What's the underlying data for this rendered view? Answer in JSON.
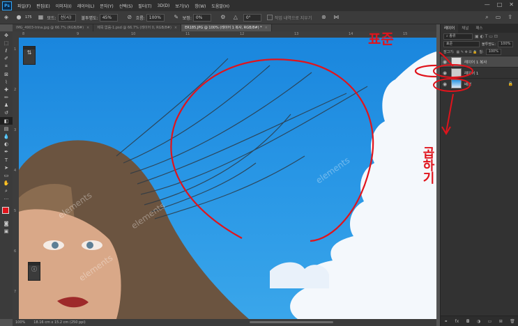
{
  "menu": {
    "logo": "Ps",
    "items": [
      "파일(F)",
      "편집(E)",
      "이미지(I)",
      "레이어(L)",
      "문자(Y)",
      "선택(S)",
      "필터(T)",
      "3D(D)",
      "보기(V)",
      "창(W)",
      "도움말(H)"
    ],
    "window_controls": [
      "—",
      "□",
      "✕"
    ]
  },
  "options": {
    "mode_label": "모드:",
    "mode_value": "선(시)",
    "opacity_label": "불투명도:",
    "opacity_value": "45%",
    "flow_label": "흐름:",
    "flow_value": "100%",
    "smooth_label": "보정:",
    "smooth_value": "0%",
    "angle_value": "0°",
    "erase_history": "작업 내역으로 지우기",
    "brush_size": "175"
  },
  "tabs": [
    {
      "label": "IMG_4903-trina.jpg @ 66.7% (RGB/8#)",
      "active": false
    },
    {
      "label": "제목 없음-1.psd @ 66.7% (레이어 0, RGB/8#)",
      "active": false
    },
    {
      "label": "ER185.JPG @ 100% (레이어 1 복사, RGB/8#) *",
      "active": true
    }
  ],
  "ruler": {
    "top": [
      "8",
      "9",
      "10",
      "11",
      "12",
      "13",
      "14",
      "15"
    ],
    "left": [
      "1",
      "2",
      "3",
      "4",
      "5",
      "6",
      "7"
    ]
  },
  "status": {
    "zoom": "100%",
    "doc_size": "18.16 cm x 15.2 cm (250 ppi)"
  },
  "panel": {
    "tabs": [
      "레이어",
      "채널",
      "패스"
    ],
    "filter_label": "종류",
    "blend_mode": "표준",
    "opacity_label": "불투명도:",
    "opacity_value": "100%",
    "lock_label": "잠그기:",
    "fill_label": "칠:",
    "fill_value": "100%",
    "layers": [
      {
        "name": "레이어 1 복사",
        "selected": true
      },
      {
        "name": "레이어 1",
        "selected": false
      },
      {
        "name": "배경",
        "selected": false,
        "locked": true
      }
    ]
  },
  "annotations": {
    "label_top": "표준",
    "label_bottom": "곱하기"
  },
  "watermarks": [
    "elements",
    "elements",
    "elements",
    "elements"
  ],
  "colors": {
    "sky": "#2a98e6",
    "annotation": "#e0141c",
    "foreground": "#e0141c",
    "background": "#ffffff"
  }
}
